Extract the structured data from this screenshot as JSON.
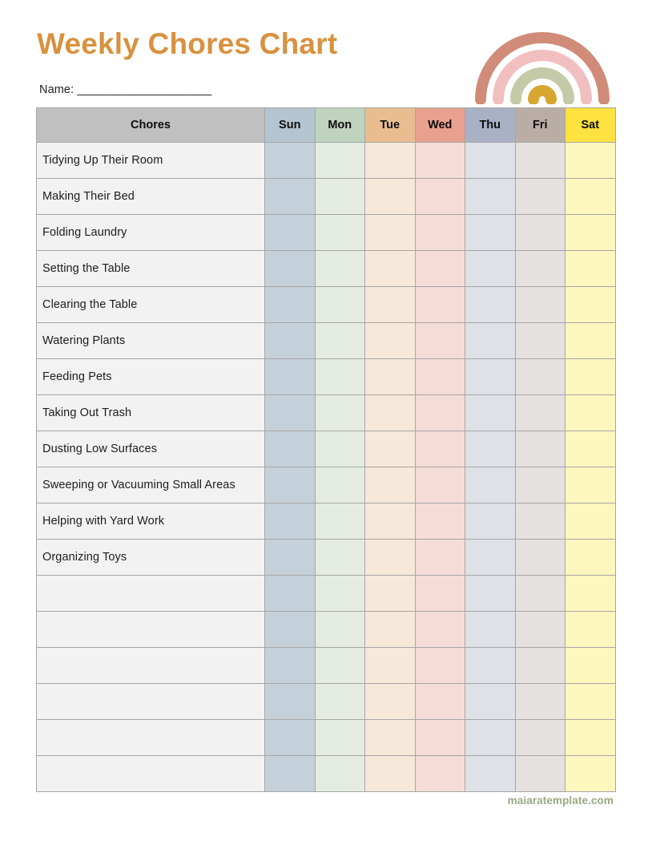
{
  "document": {
    "title": "Weekly Chores Chart",
    "title_color": "#d8913f",
    "background": "#ffffff"
  },
  "name_field": {
    "label": "Name:",
    "line": "_______________________"
  },
  "rainbow": {
    "name": "rainbow-illustration",
    "arcs": [
      {
        "name": "outer-arc",
        "color": "#d08c78"
      },
      {
        "name": "second-arc",
        "color": "#f2bfc1"
      },
      {
        "name": "third-arc",
        "color": "#c4c9a7"
      },
      {
        "name": "inner-arc",
        "color": "#d6a72f"
      }
    ]
  },
  "table": {
    "border_color": "#a6a6a6",
    "columns": [
      {
        "key": "chores",
        "label": "Chores",
        "header_bg": "#c0c0c0",
        "cell_bg": "#f2f2f2"
      },
      {
        "key": "sun",
        "label": "Sun",
        "header_bg": "#b4c4d0",
        "cell_bg": "#c5d1da"
      },
      {
        "key": "mon",
        "label": "Mon",
        "header_bg": "#bfd3bd",
        "cell_bg": "#e4ece2"
      },
      {
        "key": "tue",
        "label": "Tue",
        "header_bg": "#e9bd90",
        "cell_bg": "#f6e9da"
      },
      {
        "key": "wed",
        "label": "Wed",
        "header_bg": "#e8a18f",
        "cell_bg": "#f6dcd7"
      },
      {
        "key": "thu",
        "label": "Thu",
        "header_bg": "#a9b1c5",
        "cell_bg": "#dfe1e8"
      },
      {
        "key": "fri",
        "label": "Fri",
        "header_bg": "#b9ada5",
        "cell_bg": "#e5e1de"
      },
      {
        "key": "sat",
        "label": "Sat",
        "header_bg": "#ffe13f",
        "cell_bg": "#fdf6bd"
      }
    ],
    "rows": [
      {
        "chore": "Tidying Up Their Room"
      },
      {
        "chore": "Making Their Bed"
      },
      {
        "chore": "Folding Laundry"
      },
      {
        "chore": "Setting the Table"
      },
      {
        "chore": "Clearing the Table"
      },
      {
        "chore": "Watering Plants"
      },
      {
        "chore": "Feeding Pets"
      },
      {
        "chore": "Taking Out Trash"
      },
      {
        "chore": "Dusting Low Surfaces"
      },
      {
        "chore": "Sweeping or Vacuuming Small Areas"
      },
      {
        "chore": "Helping with Yard Work"
      },
      {
        "chore": "Organizing Toys"
      },
      {
        "chore": ""
      },
      {
        "chore": ""
      },
      {
        "chore": ""
      },
      {
        "chore": ""
      },
      {
        "chore": ""
      },
      {
        "chore": ""
      }
    ]
  },
  "footer": {
    "watermark": "maiaratemplate.com",
    "watermark_color": "#9aaa82"
  }
}
